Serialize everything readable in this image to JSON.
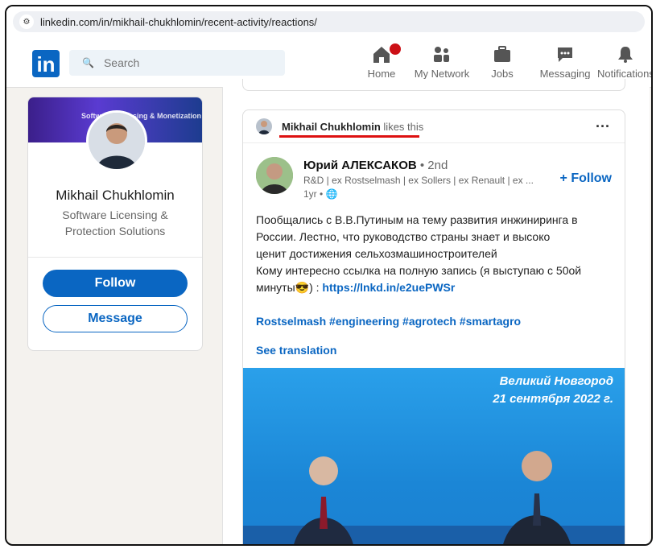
{
  "browser": {
    "url": "linkedin.com/in/mikhail-chukhlomin/recent-activity/reactions/"
  },
  "nav": {
    "logo": "in",
    "search_placeholder": "Search",
    "items": [
      {
        "label": "Home",
        "icon": "home-icon"
      },
      {
        "label": "My Network",
        "icon": "network-icon"
      },
      {
        "label": "Jobs",
        "icon": "briefcase-icon"
      },
      {
        "label": "Messaging",
        "icon": "messaging-icon"
      },
      {
        "label": "Notifications",
        "icon": "bell-icon"
      }
    ]
  },
  "profile_card": {
    "banner_text": "Software Licensing & Monetization",
    "name": "Mikhail Chukhlomin",
    "headline": "Software Licensing & Protection Solutions",
    "follow_label": "Follow",
    "message_label": "Message"
  },
  "post": {
    "actor_name": "Mikhail Chukhlomin",
    "actor_action": "likes this",
    "author_name": "Юрий АЛЕКСАКОВ",
    "author_degree": "• 2nd",
    "author_headline": "R&D | ex Rostselmash | ex Sollers | ex Renault | ex ...",
    "time": "1yr •",
    "follow_label": "+ Follow",
    "text_lines": [
      "Пообщались с В.В.Путиным на тему развития инжиниринга в",
      "России. Лестно, что руководство страны знает и высоко",
      "ценит достижения сельхозмашиностроителей",
      "Кому интересно ссылка на полную запись (я выступаю с 50ой"
    ],
    "text_last_prefix": "минуты😎) : ",
    "link": "https://lnkd.in/e2uePWSr",
    "hashtags": "Rostselmash #engineering #agrotech #smartagro",
    "see_translation": "See translation",
    "image_caption_1": "Великий Новгород",
    "image_caption_2": "21 сентября 2022 г."
  },
  "colors": {
    "brand": "#0a66c2",
    "notification_badge": "#cc1016",
    "annotation_underline": "#dd1111"
  }
}
